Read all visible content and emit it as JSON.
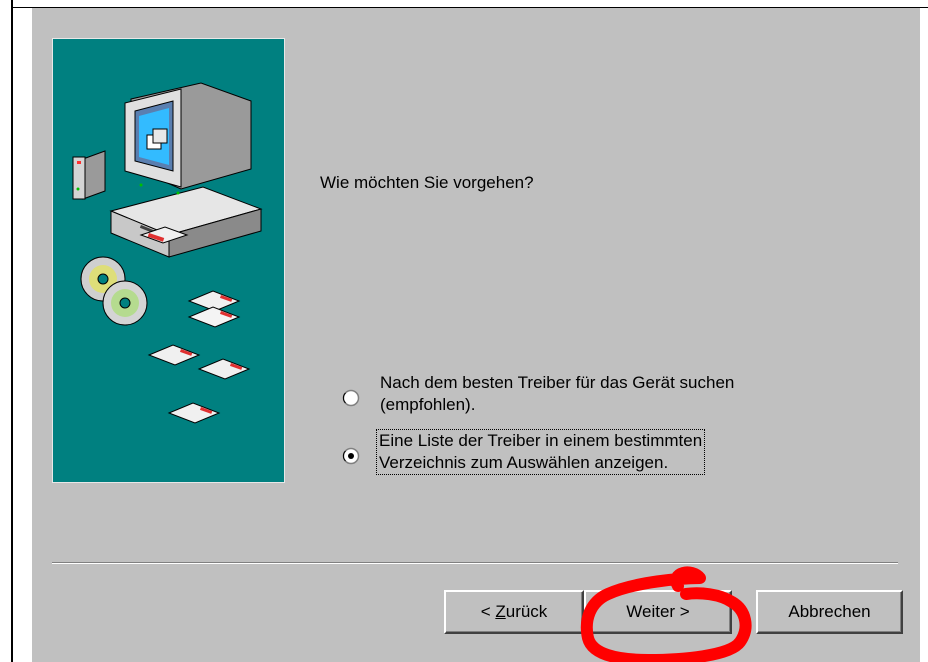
{
  "dialog": {
    "question": "Wie möchten Sie vorgehen?",
    "options": [
      {
        "line1": "Nach dem besten Treiber für das Gerät suchen",
        "line2": "(empfohlen).",
        "selected": false
      },
      {
        "line1": "Eine Liste der Treiber in einem bestimmten",
        "line2": "Verzeichnis zum Auswählen anzeigen.",
        "selected": true
      }
    ],
    "buttons": {
      "back_prefix": "< ",
      "back_mnemonic": "Z",
      "back_rest": "urück",
      "next": "Weiter >",
      "cancel": "Abbrechen"
    }
  },
  "colors": {
    "dialog_bg": "#c0c0c0",
    "illustration_bg": "#008080",
    "annotation": "#ff0000"
  }
}
